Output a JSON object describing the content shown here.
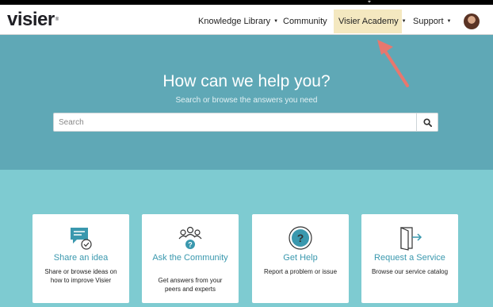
{
  "navbar": {
    "logo": "visier",
    "logo_tm": "®",
    "items": [
      {
        "label": "Knowledge Library",
        "dropdown": true
      },
      {
        "label": "Community",
        "dropdown": false
      },
      {
        "label": "Visier Academy",
        "dropdown": true,
        "highlighted": true
      },
      {
        "label": "Support",
        "dropdown": true
      }
    ],
    "caret": "▼"
  },
  "hero": {
    "title": "How can we help you?",
    "subtitle": "Search or browse the answers you need",
    "search_placeholder": "Search"
  },
  "cards": [
    {
      "title": "Share an idea",
      "description": "Share or browse ideas on how to improve Visier",
      "icon": "idea-chat-icon"
    },
    {
      "title": "Ask the Community",
      "description": "Get answers from your peers and experts",
      "icon": "community-icon"
    },
    {
      "title": "Get Help",
      "description": "Report a problem or issue",
      "icon": "help-icon"
    },
    {
      "title": "Request a Service",
      "description": "Browse our service catalog",
      "icon": "service-door-icon"
    }
  ],
  "colors": {
    "hero": "#5fa8b6",
    "page": "#7ecbd1",
    "accent": "#3a98ae",
    "highlight": "#f4e8c0",
    "arrow": "#e8776e"
  }
}
